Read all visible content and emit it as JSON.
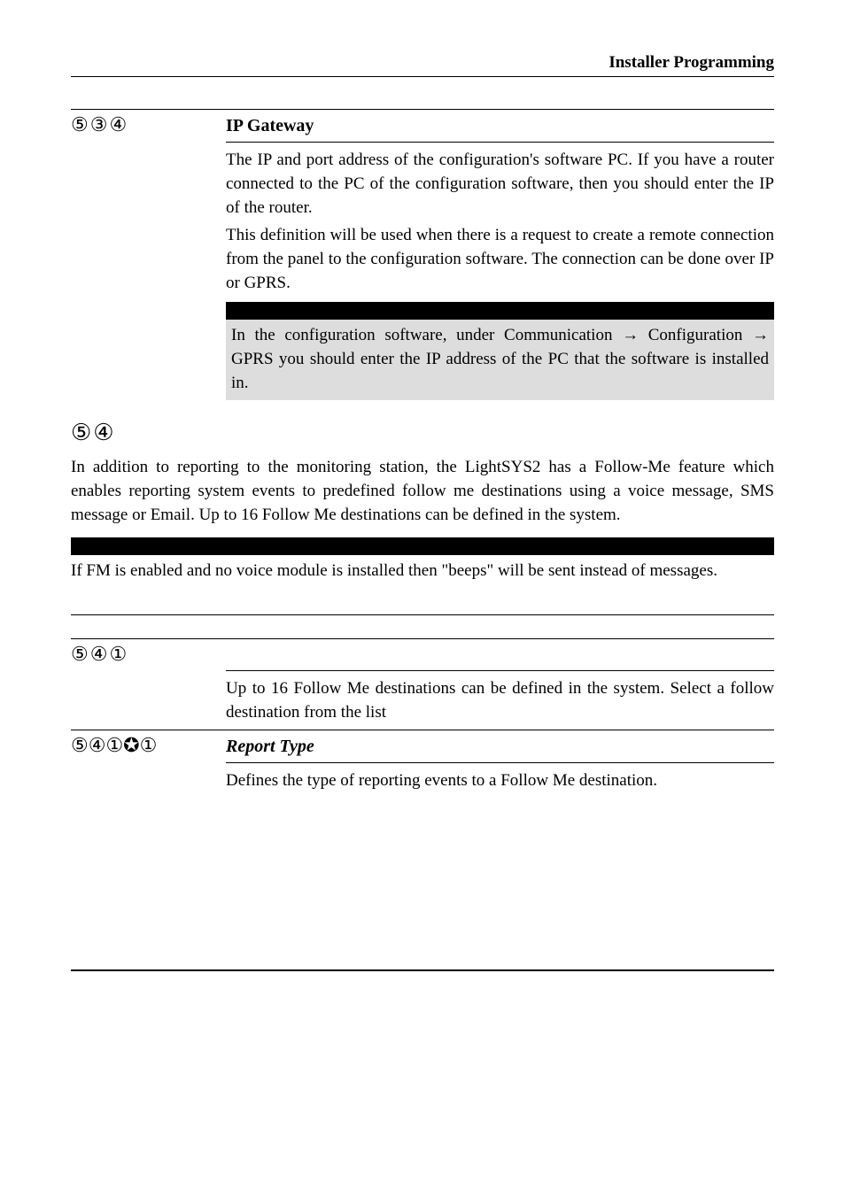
{
  "header": {
    "title": "Installer Programming"
  },
  "entry1": {
    "key": "⑤③④",
    "heading": "IP Gateway",
    "para1": "The IP and port address of the configuration's software PC. If you have a router connected to the PC of the configuration software, then you should enter the IP of the router.",
    "para2": "This definition will be used when there is a request to create a remote connection from the panel to the configuration software. The connection can be done over IP or GPRS.",
    "note_a": "In the configuration software, under Communication ",
    "note_b": " Configuration ",
    "note_c": " GPRS you should enter the IP address of the PC that the software is installed in."
  },
  "section": {
    "key": "⑤④",
    "para": "In addition to reporting to the monitoring station, the LightSYS2 has a Follow-Me feature which enables reporting system events to predefined follow me destinations using a voice message, SMS message or Email.  Up to 16 Follow Me destinations can be defined in the system.",
    "note": "If FM is enabled and no voice module is installed then \"beeps\" will be sent instead of messages."
  },
  "entry2": {
    "key": "⑤④①",
    "body": "Up to 16 Follow Me destinations can be defined in the system. Select a follow destination from the list"
  },
  "entry3": {
    "key": "⑤④①✪①",
    "heading": "Report Type",
    "body": "Defines the type of reporting events to a Follow Me destination."
  },
  "arrow": "→"
}
